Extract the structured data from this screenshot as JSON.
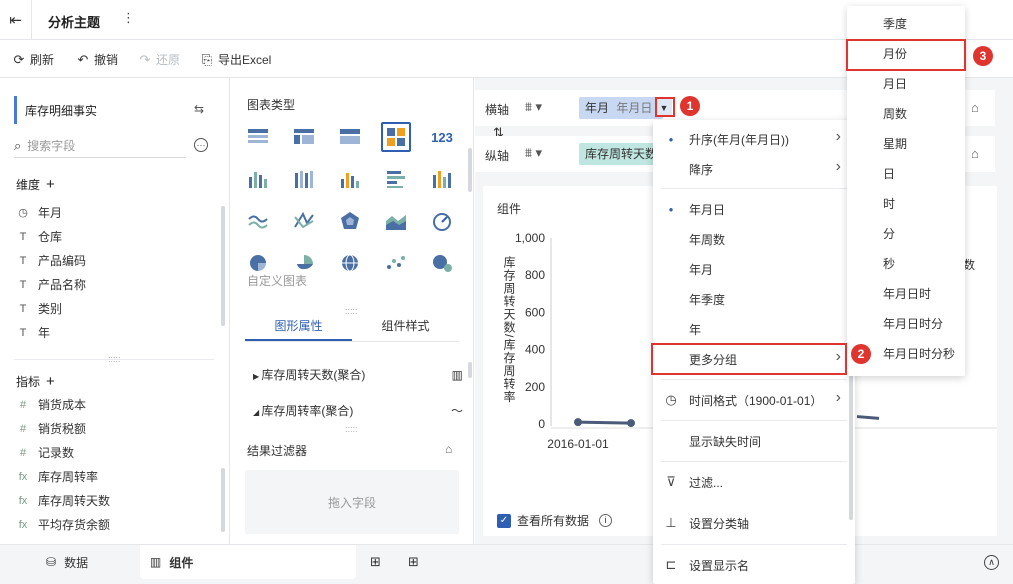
{
  "topbar": {
    "title": "分析主题",
    "back_icon": "exit-icon",
    "kebab": "⋮"
  },
  "toolbar": {
    "refresh": "刷新",
    "undo": "撤销",
    "redo": "还原",
    "export": "导出Excel"
  },
  "left": {
    "table_name": "库存明细事实",
    "search_placeholder": "搜索字段",
    "dimension_title": "维度",
    "dimensions": [
      {
        "icon": "◷",
        "label": "年月"
      },
      {
        "icon": "T",
        "label": "仓库"
      },
      {
        "icon": "T",
        "label": "产品编码"
      },
      {
        "icon": "T",
        "label": "产品名称"
      },
      {
        "icon": "T",
        "label": "类别"
      },
      {
        "icon": "T",
        "label": "年"
      }
    ],
    "measure_title": "指标",
    "measures": [
      {
        "icon": "#",
        "label": "销货成本"
      },
      {
        "icon": "#",
        "label": "销货税额"
      },
      {
        "icon": "#",
        "label": "记录数"
      },
      {
        "icon": "fx",
        "label": "库存周转率"
      },
      {
        "icon": "fx",
        "label": "库存周转天数"
      },
      {
        "icon": "fx",
        "label": "平均存货余额"
      }
    ]
  },
  "mid": {
    "chart_type_title": "图表类型",
    "custom_chart": "自定义图表",
    "tabs": [
      "图形属性",
      "组件样式"
    ],
    "prop_rows": [
      "库存周转天数(聚合)",
      "库存周转率(聚合)"
    ],
    "filter_title": "结果过滤器",
    "filter_drop": "拖入字段"
  },
  "main": {
    "x_axis_label": "横轴",
    "y_axis_label": "纵轴",
    "x_pill_main": "年月",
    "x_pill_sub": "年月日",
    "y_pill": "库存周转天数",
    "chart_title": "组件",
    "view_all": "查看所有数据",
    "right_cut_text": "数"
  },
  "chart_data": {
    "type": "line",
    "ylabel": "库存周转天数/库存周转率",
    "yticks": [
      "1,000",
      "800",
      "600",
      "400",
      "200",
      "0"
    ],
    "ylim": [
      0,
      1000
    ],
    "x": [
      "2016-01-01"
    ],
    "x_tick_cut": "2",
    "series": [
      {
        "values": [
          10,
          5
        ]
      }
    ]
  },
  "dropdown": {
    "items": [
      {
        "label": "升序(年月(年月日))",
        "dot": true,
        "arrow": true
      },
      {
        "label": "降序",
        "dot": false,
        "arrow": true
      },
      {
        "label": "年月日",
        "dot": true,
        "arrow": false
      },
      {
        "label": "年周数",
        "dot": false,
        "arrow": false
      },
      {
        "label": "年月",
        "dot": false,
        "arrow": false
      },
      {
        "label": "年季度",
        "dot": false,
        "arrow": false
      },
      {
        "label": "年",
        "dot": false,
        "arrow": false
      },
      {
        "label": "更多分组",
        "dot": false,
        "arrow": true
      },
      {
        "label": "时间格式（1900-01-01）",
        "icon": "◷",
        "arrow": true
      },
      {
        "label": "显示缺失时间",
        "arrow": false
      },
      {
        "label": "过滤...",
        "icon": "⊽",
        "arrow": false
      },
      {
        "label": "设置分类轴",
        "icon": "⊥",
        "arrow": false
      },
      {
        "label": "设置显示名",
        "icon": "⊏",
        "arrow": false
      }
    ]
  },
  "submenu": {
    "items": [
      "季度",
      "月份",
      "月日",
      "周数",
      "星期",
      "日",
      "时",
      "分",
      "秒",
      "年月日时",
      "年月日时分",
      "年月日时分秒"
    ]
  },
  "badges": [
    "1",
    "2",
    "3"
  ],
  "bottom": {
    "data_tab": "数据",
    "component_tab": "组件"
  },
  "colors": {
    "accent": "#2f5fb3",
    "highlight": "#e0342f",
    "line": "#4a5a78"
  }
}
